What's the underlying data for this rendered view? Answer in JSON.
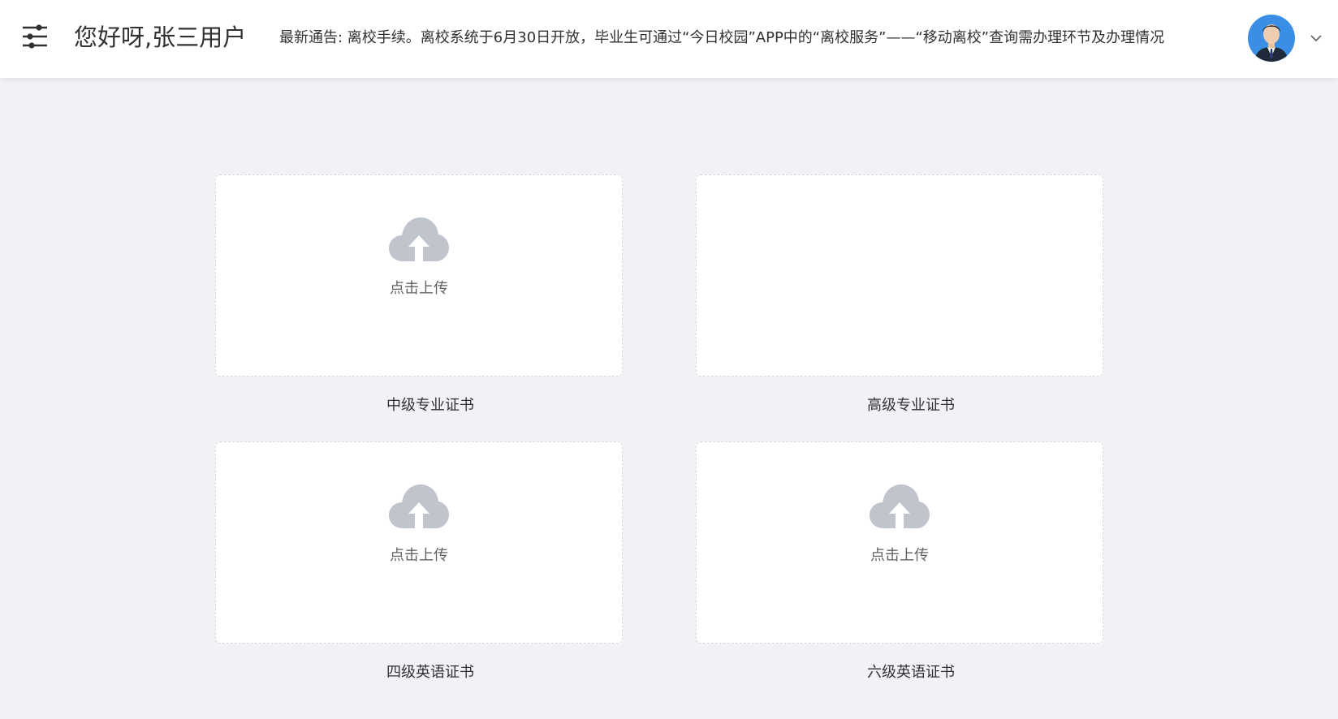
{
  "header": {
    "greeting": "您好呀,张三用户",
    "notice": "最新通告:  离校手续。离校系统于6月30日开放，毕业生可通过“今日校园”APP中的“离校服务”——“移动离校”查询需办理环节及办理情况"
  },
  "certificates": [
    {
      "title": "中级专业证书",
      "upload_label": "点击上传"
    },
    {
      "title": "高级专业证书",
      "upload_label": ""
    },
    {
      "title": "四级英语证书",
      "upload_label": "点击上传"
    },
    {
      "title": "六级英语证书",
      "upload_label": "点击上传"
    }
  ],
  "colors": {
    "background": "#f0f2f5",
    "upload_icon": "#c0c4cc",
    "avatar_background": "#3a8ee6"
  }
}
